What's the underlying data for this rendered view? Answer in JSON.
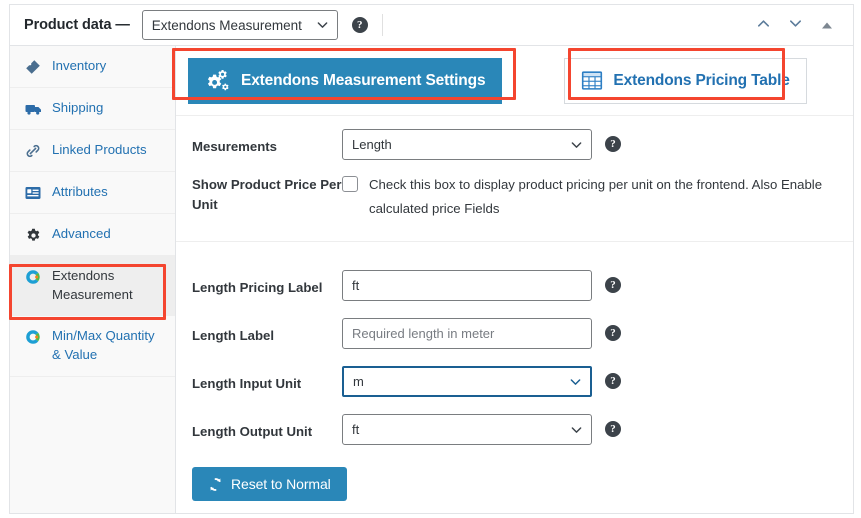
{
  "header": {
    "title": "Product data —",
    "product_type": {
      "value": "Extendons Measurement",
      "caret_icon": "chevron-down-icon"
    },
    "help_icon": "help-circle-icon",
    "actions": [
      {
        "name": "move-up-button",
        "icon": "chevron-up-icon"
      },
      {
        "name": "move-down-button",
        "icon": "chevron-down-icon"
      },
      {
        "name": "collapse-panel-button",
        "icon": "triangle-up-icon"
      }
    ]
  },
  "sidebar": {
    "items": [
      {
        "label": "Inventory",
        "icon": "inventory-tag-icon",
        "active": false
      },
      {
        "label": "Shipping",
        "icon": "truck-icon",
        "active": false
      },
      {
        "label": "Linked Products",
        "icon": "link-icon",
        "active": false
      },
      {
        "label": "Attributes",
        "icon": "attributes-list-icon",
        "active": false
      },
      {
        "label": "Advanced",
        "icon": "gear-icon",
        "active": false
      },
      {
        "label": "Extendons Measurement",
        "icon": "extendons-logo-icon",
        "active": true
      },
      {
        "label": "Min/Max Quantity & Value",
        "icon": "extendons-logo-icon",
        "active": false
      }
    ]
  },
  "subtabs": [
    {
      "label": "Extendons Measurement Settings",
      "icon": "gears-icon",
      "active": true
    },
    {
      "label": "Extendons Pricing Table",
      "icon": "table-grid-icon",
      "active": false
    }
  ],
  "fields": {
    "measurements": {
      "label": "Mesurements",
      "value": "Length",
      "caret_icon": "chevron-down-icon",
      "help_icon": "help-circle-icon"
    },
    "show_price_per_unit": {
      "label": "Show Product Price Per Unit",
      "checked": false,
      "description": "Check this box to display product pricing per unit on the frontend. Also Enable calculated price Fields"
    },
    "length_pricing_label": {
      "label": "Length Pricing Label",
      "value": "ft",
      "is_placeholder": false,
      "help_icon": "help-circle-icon"
    },
    "length_label": {
      "label": "Length Label",
      "value": "Required length in meter",
      "is_placeholder": true,
      "help_icon": "help-circle-icon"
    },
    "length_input_unit": {
      "label": "Length Input Unit",
      "value": "m",
      "focused": true,
      "caret_icon": "chevron-down-icon",
      "help_icon": "help-circle-icon"
    },
    "length_output_unit": {
      "label": "Length Output Unit",
      "value": "ft",
      "focused": false,
      "caret_icon": "chevron-down-icon",
      "help_icon": "help-circle-icon"
    }
  },
  "reset_button": {
    "label": "Reset to Normal",
    "icon": "refresh-icon"
  },
  "colors": {
    "accent_blue": "#2a87b8",
    "link_blue": "#2271b1",
    "annotation_red": "#f4452f",
    "focus_blue": "#1a5f92",
    "sidebar_bg": "#f9f9f9",
    "border_gray": "#e2e4e7"
  }
}
